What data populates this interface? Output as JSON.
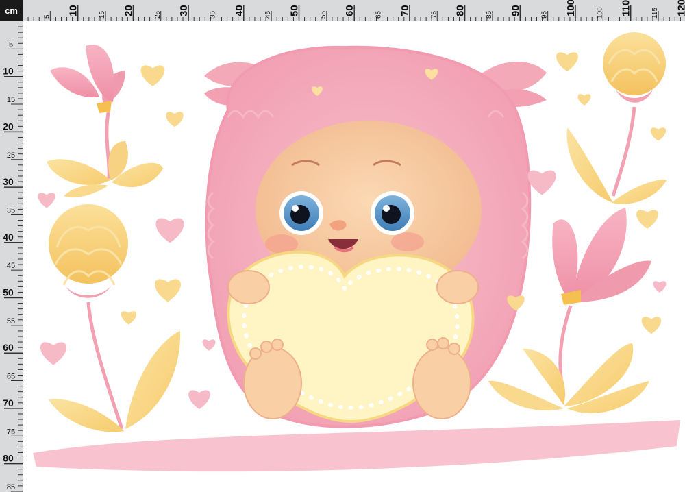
{
  "ruler": {
    "unit": "cm",
    "top_labels": [
      "5",
      "10",
      "15",
      "20",
      "25",
      "30",
      "35",
      "40",
      "45",
      "50",
      "55",
      "60",
      "65",
      "70",
      "75",
      "80",
      "85",
      "90",
      "95",
      "100",
      "105",
      "110",
      "115",
      "120"
    ],
    "left_labels": [
      "5",
      "10",
      "15",
      "20",
      "25",
      "30",
      "35",
      "40",
      "45",
      "50",
      "55",
      "60",
      "65",
      "70",
      "75",
      "80",
      "85"
    ]
  },
  "colors": {
    "ruler_bg": "#d9dadc",
    "corner_bg": "#1a1a1a",
    "pink": "#f4a9b8",
    "pink_dark": "#e98aa0",
    "yellow": "#f7d27a",
    "yellow_light": "#fbe3a2",
    "skin": "#f9cfa6",
    "heart_cream": "#fff4c4"
  },
  "illustration": {
    "subject": "pink-hedgehog-holding-heart",
    "icons": [
      "tulip-icon",
      "yellow-flower-icon",
      "leaf-icon",
      "heart-icon",
      "hedgehog-icon"
    ]
  }
}
